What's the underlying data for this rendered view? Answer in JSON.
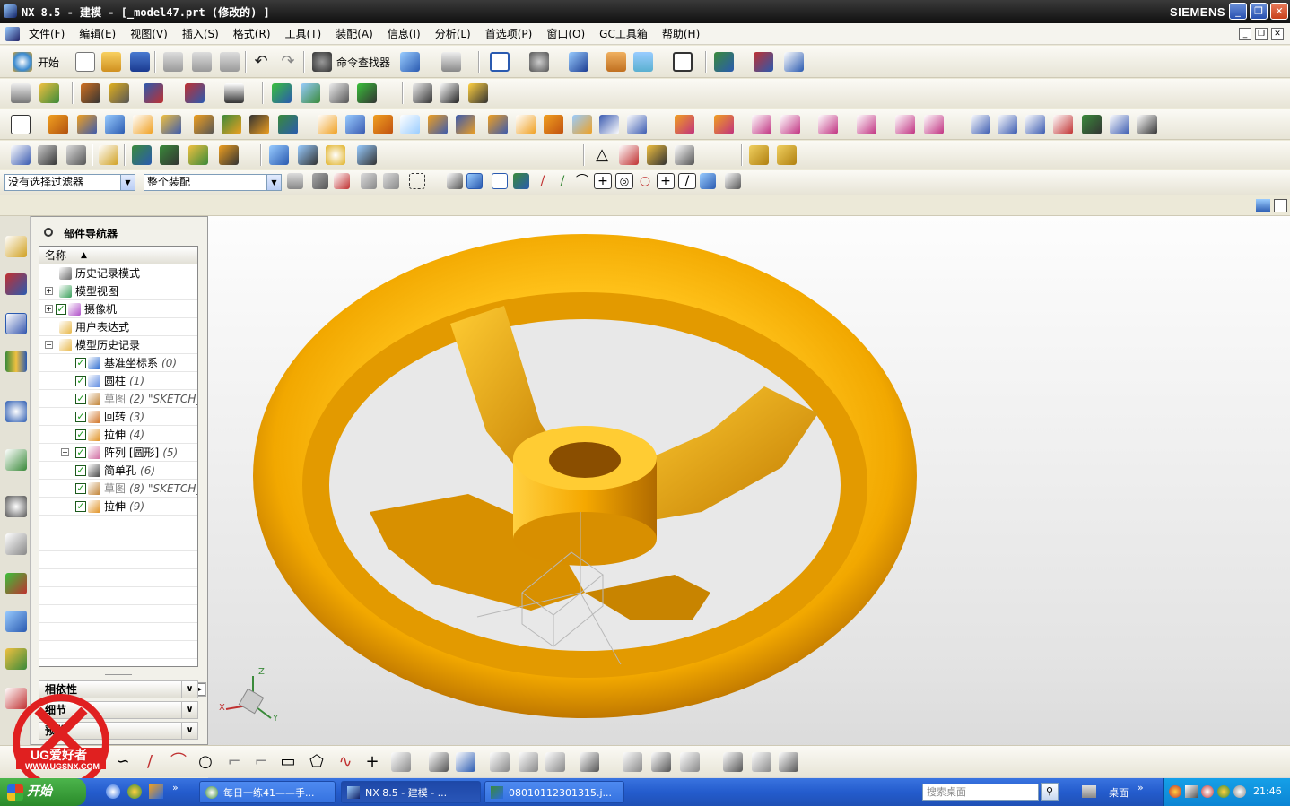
{
  "window": {
    "title": "NX 8.5 - 建模 - [_model47.prt  (修改的) ]",
    "brand": "SIEMENS",
    "controls": {
      "minimize": "_",
      "restore": "❐",
      "close": "✕"
    }
  },
  "menubar": [
    "文件(F)",
    "编辑(E)",
    "视图(V)",
    "插入(S)",
    "格式(R)",
    "工具(T)",
    "装配(A)",
    "信息(I)",
    "分析(L)",
    "首选项(P)",
    "窗口(O)",
    "GC工具箱",
    "帮助(H)"
  ],
  "toolbar1": {
    "start_label": "开始",
    "command_finder_label": "命令查找器"
  },
  "filters": {
    "selection_filter": "没有选择过滤器",
    "scope": "整个装配"
  },
  "navigator": {
    "title": "部件导航器",
    "column_header": "名称",
    "items": [
      {
        "label": "历史记录模式",
        "num": "",
        "extra": "",
        "level": 0,
        "expander": "",
        "check": false,
        "icon": "history-icon",
        "color": "#6a6a6a"
      },
      {
        "label": "模型视图",
        "num": "",
        "extra": "",
        "level": 0,
        "expander": "+",
        "check": false,
        "icon": "model-views-icon",
        "color": "#3aa05a"
      },
      {
        "label": "摄像机",
        "num": "",
        "extra": "",
        "level": 0,
        "expander": "+",
        "check": true,
        "icon": "camera-icon",
        "color": "#b050c8"
      },
      {
        "label": "用户表达式",
        "num": "",
        "extra": "",
        "level": 0,
        "expander": "",
        "check": false,
        "icon": "folder-icon",
        "color": "#e8b84a"
      },
      {
        "label": "模型历史记录",
        "num": "",
        "extra": "",
        "level": 0,
        "expander": "−",
        "check": false,
        "icon": "folder-open-icon",
        "color": "#e8b84a"
      },
      {
        "label": "基准坐标系",
        "num": "(0)",
        "extra": "",
        "level": 1,
        "expander": "",
        "check": true,
        "icon": "datum-csys-icon",
        "color": "#2a6ad0"
      },
      {
        "label": "圆柱",
        "num": "(1)",
        "extra": "",
        "level": 1,
        "expander": "",
        "check": true,
        "icon": "cylinder-icon",
        "color": "#5a88e0"
      },
      {
        "label": "草图",
        "num": "(2)",
        "extra": "\"SKETCH_",
        "level": 1,
        "expander": "",
        "check": true,
        "icon": "sketch-icon",
        "color": "#c08030",
        "grey": true
      },
      {
        "label": "回转",
        "num": "(3)",
        "extra": "",
        "level": 1,
        "expander": "",
        "check": true,
        "icon": "revolve-icon",
        "color": "#d07020"
      },
      {
        "label": "拉伸",
        "num": "(4)",
        "extra": "",
        "level": 1,
        "expander": "",
        "check": true,
        "icon": "extrude-icon",
        "color": "#e09020"
      },
      {
        "label": "阵列 [圆形]",
        "num": "(5)",
        "extra": "",
        "level": 1,
        "expander": "+",
        "check": true,
        "icon": "pattern-icon",
        "color": "#d06aa0"
      },
      {
        "label": "简单孔",
        "num": "(6)",
        "extra": "",
        "level": 1,
        "expander": "",
        "check": true,
        "icon": "hole-icon",
        "color": "#444"
      },
      {
        "label": "草图",
        "num": "(8)",
        "extra": "\"SKETCH_",
        "level": 1,
        "expander": "",
        "check": true,
        "icon": "sketch-icon",
        "color": "#c08030",
        "grey": true
      },
      {
        "label": "拉伸",
        "num": "(9)",
        "extra": "",
        "level": 1,
        "expander": "",
        "check": true,
        "icon": "extrude-icon",
        "color": "#e09020"
      }
    ],
    "panels": [
      "相依性",
      "细节",
      "预览"
    ]
  },
  "viewport": {
    "model_color": "#f2a800",
    "triad": {
      "z": "Z",
      "y": "Y",
      "x": "X"
    }
  },
  "watermark": {
    "text": "UG爱好者",
    "url_text": "WWW.UGSNX.COM"
  },
  "taskbar": {
    "start_label": "开始",
    "tasks": [
      "每日一练41——手...",
      "NX 8.5 - 建模 - ...",
      "08010112301315.j..."
    ],
    "search_placeholder": "搜索桌面",
    "desktop_label": "桌面",
    "clock": "21:46"
  }
}
